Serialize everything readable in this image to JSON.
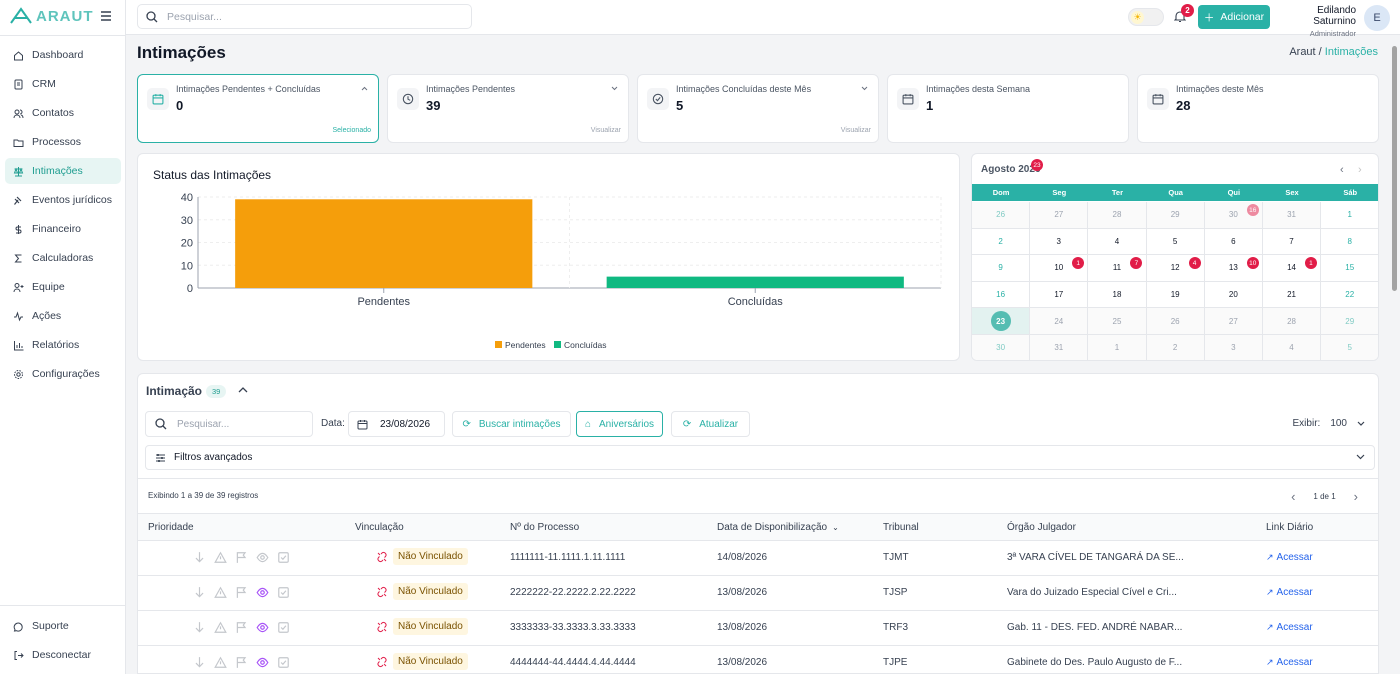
{
  "app": {
    "logo_text": "ARAUT"
  },
  "sidebar": {
    "items": [
      {
        "label": "Dashboard",
        "icon": "home-icon"
      },
      {
        "label": "CRM",
        "icon": "contacts-book-icon"
      },
      {
        "label": "Contatos",
        "icon": "users-icon"
      },
      {
        "label": "Processos",
        "icon": "folder-icon"
      },
      {
        "label": "Intimações",
        "icon": "scale-icon",
        "active": true
      },
      {
        "label": "Eventos jurídicos",
        "icon": "gavel-icon"
      },
      {
        "label": "Financeiro",
        "icon": "dollar-icon"
      },
      {
        "label": "Calculadoras",
        "icon": "sigma-icon"
      },
      {
        "label": "Equipe",
        "icon": "user-plus-icon"
      },
      {
        "label": "Ações",
        "icon": "activity-icon"
      },
      {
        "label": "Relatórios",
        "icon": "bar-chart-icon"
      },
      {
        "label": "Configurações",
        "icon": "gear-icon"
      }
    ],
    "bottom": [
      {
        "label": "Suporte",
        "icon": "chat-icon"
      },
      {
        "label": "Desconectar",
        "icon": "logout-icon"
      }
    ]
  },
  "topbar": {
    "search_placeholder": "Pesquisar...",
    "notifications": "2",
    "add_label": "Adicionar",
    "user_name": "Edilando Saturnino",
    "user_role": "Administrador",
    "avatar_initial": "E"
  },
  "page": {
    "title": "Intimações",
    "breadcrumb_root": "Araut",
    "breadcrumb_sep": "/",
    "breadcrumb_current": "Intimações"
  },
  "cards": [
    {
      "label": "Intimações Pendentes + Concluídas",
      "value": "0",
      "foot": "Selecionado",
      "chevron": "up"
    },
    {
      "label": "Intimações Pendentes",
      "value": "39",
      "foot": "Visualizar",
      "chevron": "down"
    },
    {
      "label": "Intimações Concluídas deste Mês",
      "value": "5",
      "foot": "Visualizar",
      "chevron": "down"
    },
    {
      "label": "Intimações desta Semana",
      "value": "1",
      "foot": "",
      "chevron": ""
    },
    {
      "label": "Intimações deste Mês",
      "value": "28",
      "foot": "",
      "chevron": ""
    }
  ],
  "chart_data": {
    "type": "bar",
    "title": "Status das Intimações",
    "categories": [
      "Pendentes",
      "Concluídas"
    ],
    "values": [
      39,
      5
    ],
    "colors": [
      "#f59e0b",
      "#10b981"
    ],
    "ylim": [
      0,
      40
    ],
    "yticks": [
      0,
      10,
      20,
      30,
      40
    ],
    "legend": [
      "Pendentes",
      "Concluídas"
    ],
    "legend_position": "bottom",
    "grid": true
  },
  "calendar": {
    "title": "Agosto 2026",
    "badge": "23",
    "weekdays": [
      "Dom",
      "Seg",
      "Ter",
      "Qua",
      "Qui",
      "Sex",
      "Sáb"
    ],
    "weeks": [
      [
        {
          "d": "26",
          "m": true
        },
        {
          "d": "27",
          "m": true
        },
        {
          "d": "28",
          "m": true
        },
        {
          "d": "29",
          "m": true
        },
        {
          "d": "30",
          "m": true,
          "c": "16",
          "fade": true
        },
        {
          "d": "31",
          "m": true
        },
        {
          "d": "1"
        }
      ],
      [
        {
          "d": "2"
        },
        {
          "d": "3"
        },
        {
          "d": "4"
        },
        {
          "d": "5"
        },
        {
          "d": "6"
        },
        {
          "d": "7"
        },
        {
          "d": "8"
        }
      ],
      [
        {
          "d": "9"
        },
        {
          "d": "10",
          "c": "1"
        },
        {
          "d": "11",
          "c": "7"
        },
        {
          "d": "12",
          "c": "4"
        },
        {
          "d": "13",
          "c": "10"
        },
        {
          "d": "14",
          "c": "1"
        },
        {
          "d": "15"
        }
      ],
      [
        {
          "d": "16"
        },
        {
          "d": "17"
        },
        {
          "d": "18"
        },
        {
          "d": "19"
        },
        {
          "d": "20"
        },
        {
          "d": "21"
        },
        {
          "d": "22"
        }
      ],
      [
        {
          "d": "23",
          "today": true
        },
        {
          "d": "24",
          "m": true
        },
        {
          "d": "25",
          "m": true
        },
        {
          "d": "26",
          "m": true
        },
        {
          "d": "27",
          "m": true
        },
        {
          "d": "28",
          "m": true
        },
        {
          "d": "29",
          "m": true
        }
      ],
      [
        {
          "d": "30",
          "m": true
        },
        {
          "d": "31",
          "m": true
        },
        {
          "d": "1",
          "m": true
        },
        {
          "d": "2",
          "m": true
        },
        {
          "d": "3",
          "m": true
        },
        {
          "d": "4",
          "m": true
        },
        {
          "d": "5",
          "m": true
        }
      ]
    ]
  },
  "list": {
    "title": "Intimação",
    "count": "39",
    "search_placeholder": "Pesquisar...",
    "date_label": "Data:",
    "date_value": "23/08/2026",
    "btn_buscar": "Buscar intimações",
    "btn_aniversarios": "Aniversários",
    "btn_atualizar": "Atualizar",
    "exibir_label": "Exibir:",
    "exibir_value": "100",
    "filtros_label": "Filtros avançados",
    "exibindo": "Exibindo 1 a 39 de 39 registros",
    "page": "1 de 1",
    "columns": [
      "Prioridade",
      "Vinculação",
      "Nº do Processo",
      "Data de Disponibilização",
      "Tribunal",
      "Órgão Julgador",
      "Link Diário"
    ],
    "rows": [
      {
        "vinc": "Não Vinculado",
        "proc": "1111111-11.1111.1.11.1111",
        "data": "14/08/2026",
        "trib": "TJMT",
        "orgao": "3ª VARA CÍVEL DE TANGARÁ DA SE...",
        "link": "Acessar",
        "eye": false
      },
      {
        "vinc": "Não Vinculado",
        "proc": "2222222-22.2222.2.22.2222",
        "data": "13/08/2026",
        "trib": "TJSP",
        "orgao": "Vara do Juizado Especial Cível e Cri...",
        "link": "Acessar",
        "eye": true
      },
      {
        "vinc": "Não Vinculado",
        "proc": "3333333-33.3333.3.33.3333",
        "data": "13/08/2026",
        "trib": "TRF3",
        "orgao": "Gab. 11 - DES. FED. ANDRÉ NABAR...",
        "link": "Acessar",
        "eye": true
      },
      {
        "vinc": "Não Vinculado",
        "proc": "4444444-44.4444.4.44.4444",
        "data": "13/08/2026",
        "trib": "TJPE",
        "orgao": "Gabinete do Des. Paulo Augusto de F...",
        "link": "Acessar",
        "eye": true
      }
    ]
  },
  "colors": {
    "accent": "#2ab1a6",
    "danger": "#e11d48",
    "pending": "#f59e0b",
    "done": "#10b981"
  }
}
